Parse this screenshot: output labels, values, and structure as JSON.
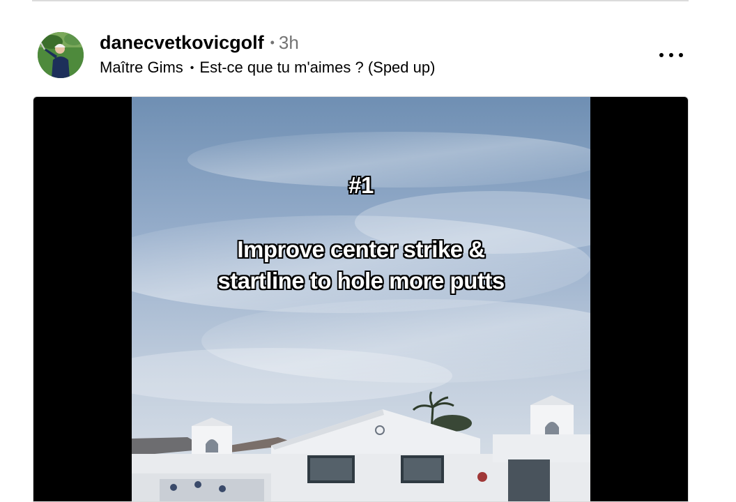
{
  "post": {
    "username": "danecvetkovicgolf",
    "separator": "•",
    "time": "3h",
    "audio_artist": "Maître Gims",
    "audio_separator": "•",
    "audio_title": "Est-ce que tu m'aimes ? (Sped up)",
    "more_icon": "more-horizontal-icon"
  },
  "video": {
    "overlay_number": "#1",
    "overlay_caption_line1": "Improve center strike &",
    "overlay_caption_line2": "startline to hole more putts"
  },
  "colors": {
    "username": "#000000",
    "meta": "#737373",
    "letterbox": "#000000",
    "divider": "#dbdbdb"
  }
}
